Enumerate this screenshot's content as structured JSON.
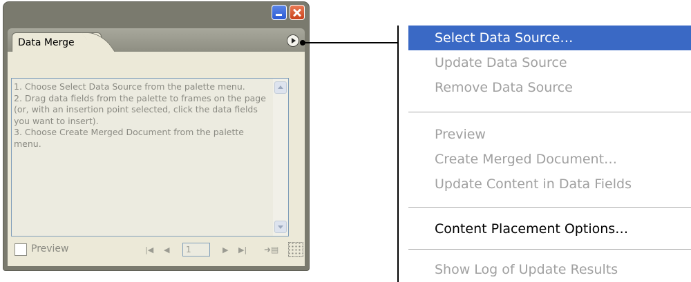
{
  "palette": {
    "tab_label": "Data Merge",
    "help_text": "1. Choose Select Data Source from the palette menu.\n2. Drag data fields from the palette to frames on the page (or, with an insertion point selected, click the data fields you want to insert).\n3. Choose Create Merged Document from the palette menu.",
    "preview_label": "Preview",
    "page_number": "1",
    "preview_checked": false
  },
  "menu": {
    "items": [
      {
        "label": "Select Data Source…",
        "state": "selected"
      },
      {
        "label": "Update Data Source",
        "state": "disabled"
      },
      {
        "label": "Remove Data Source",
        "state": "disabled"
      },
      {
        "label": "Preview",
        "state": "disabled"
      },
      {
        "label": "Create Merged Document…",
        "state": "disabled"
      },
      {
        "label": "Update Content in Data Fields",
        "state": "disabled"
      },
      {
        "label": "Content Placement Options…",
        "state": "enabled"
      },
      {
        "label": "Show Log of Update Results",
        "state": "disabled"
      }
    ],
    "highlight_color": "#3a69c5",
    "disabled_color": "#a0a0a0"
  },
  "icons": {
    "minimize": "minimize-icon",
    "close": "close-icon",
    "palette_menu": "palette-menu-icon",
    "scroll_up": "scroll-up-icon",
    "scroll_down": "scroll-down-icon",
    "first_record": "first-record-icon",
    "previous_record": "previous-record-icon",
    "next_record": "next-record-icon",
    "last_record": "last-record-icon",
    "create_merged_document": "create-merged-document-icon",
    "resize_grip": "resize-grip-icon"
  }
}
